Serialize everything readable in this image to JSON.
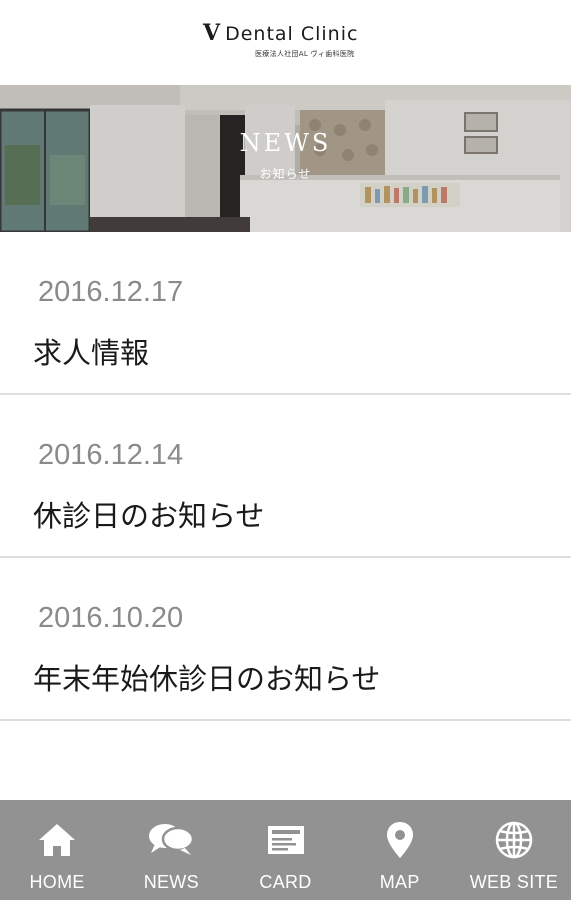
{
  "header": {
    "logo_mark": "V",
    "logo_text": "Dental Clinic",
    "logo_subtext": "医療法人社団AL ヴィ歯科医院"
  },
  "banner": {
    "title": "NEWS",
    "subtitle": "お知らせ"
  },
  "news": [
    {
      "date": "2016.12.17",
      "title": "求人情報"
    },
    {
      "date": "2016.12.14",
      "title": "休診日のお知らせ"
    },
    {
      "date": "2016.10.20",
      "title": "年末年始休診日のお知らせ"
    }
  ],
  "nav": [
    {
      "label": "HOME",
      "icon": "home-icon"
    },
    {
      "label": "NEWS",
      "icon": "chat-bubbles-icon"
    },
    {
      "label": "CARD",
      "icon": "card-icon"
    },
    {
      "label": "MAP",
      "icon": "map-pin-icon"
    },
    {
      "label": "WEB SITE",
      "icon": "globe-icon"
    }
  ],
  "colors": {
    "nav_background": "#929292",
    "date_text": "#8a8a8a",
    "divider": "#dedede"
  }
}
